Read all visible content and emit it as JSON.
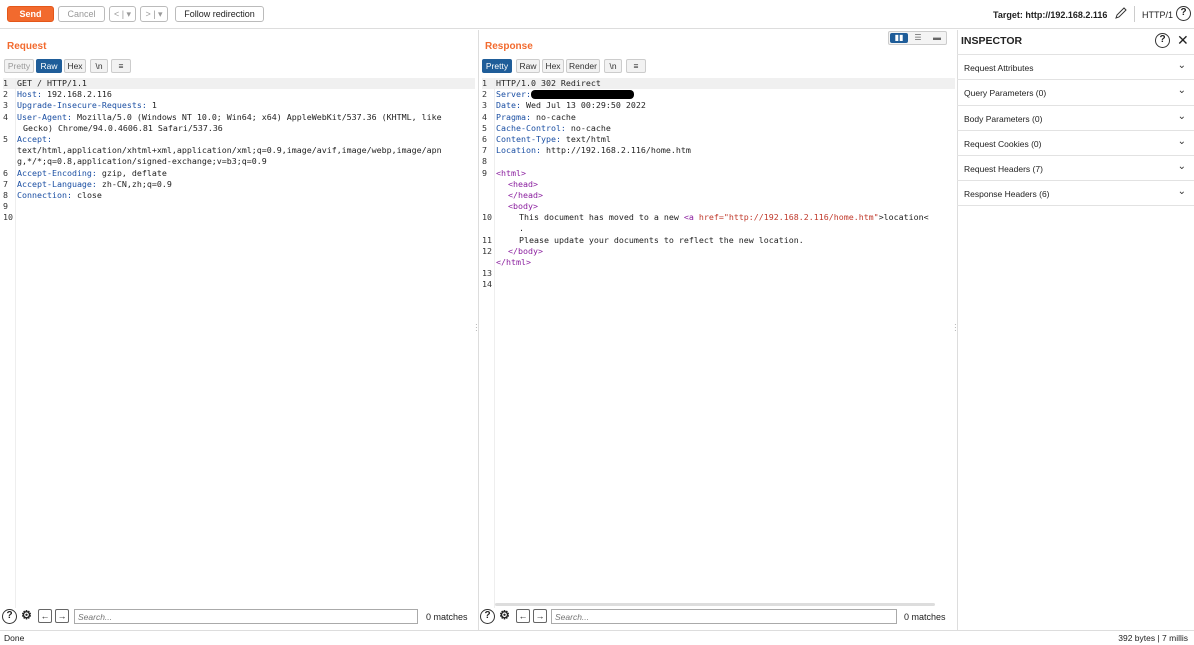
{
  "toolbar": {
    "send": "Send",
    "cancel": "Cancel",
    "back": "< | ▾",
    "forward": "> | ▾",
    "follow": "Follow redirection",
    "target": "Target: http://192.168.2.116",
    "http_version": "HTTP/1",
    "help": "?"
  },
  "request": {
    "title": "Request",
    "tabs": [
      "Pretty",
      "Raw",
      "Hex",
      "\\n",
      "≡"
    ],
    "active_tab": "Raw",
    "lines": [
      {
        "n": "1",
        "key": "",
        "val": "GET / HTTP/1.1"
      },
      {
        "n": "2",
        "key": "Host:",
        "val": " 192.168.2.116"
      },
      {
        "n": "3",
        "key": "Upgrade-Insecure-Requests:",
        "val": " 1"
      },
      {
        "n": "4",
        "key": "User-Agent:",
        "val": " Mozilla/5.0 (Windows NT 10.0; Win64; x64) AppleWebKit/537.36 (KHTML, like"
      },
      {
        "n": "",
        "key": "",
        "val": "Gecko) Chrome/94.0.4606.81 Safari/537.36"
      },
      {
        "n": "5",
        "key": "Accept:",
        "val": ""
      },
      {
        "n": "",
        "key": "",
        "val": "text/html,application/xhtml+xml,application/xml;q=0.9,image/avif,image/webp,image/apn"
      },
      {
        "n": "",
        "key": "",
        "val": "g,*/*;q=0.8,application/signed-exchange;v=b3;q=0.9"
      },
      {
        "n": "6",
        "key": "Accept-Encoding:",
        "val": " gzip, deflate"
      },
      {
        "n": "7",
        "key": "Accept-Language:",
        "val": " zh-CN,zh;q=0.9"
      },
      {
        "n": "8",
        "key": "Connection:",
        "val": " close"
      },
      {
        "n": "9",
        "key": "",
        "val": ""
      },
      {
        "n": "10",
        "key": "",
        "val": ""
      }
    ],
    "search_placeholder": "Search...",
    "matches": "0 matches"
  },
  "response": {
    "title": "Response",
    "tabs": [
      "Pretty",
      "Raw",
      "Hex",
      "Render",
      "\\n",
      "≡"
    ],
    "active_tab": "Pretty",
    "status_line": "HTTP/1.0 302 Redirect",
    "headers": [
      {
        "n": "2",
        "key": "Server:",
        "val": ""
      },
      {
        "n": "3",
        "key": "Date:",
        "val": " Wed Jul 13 00:29:50 2022"
      },
      {
        "n": "4",
        "key": "Pragma:",
        "val": " no-cache"
      },
      {
        "n": "5",
        "key": "Cache-Control:",
        "val": " no-cache"
      },
      {
        "n": "6",
        "key": "Content-Type:",
        "val": " text/html"
      },
      {
        "n": "7",
        "key": "Location:",
        "val": " http://192.168.2.116/home.htm"
      }
    ],
    "html_open": "<html>",
    "head_open": "<head>",
    "head_close": "</head>",
    "body_open": "<body>",
    "moved_text": "This document has moved to a new ",
    "a_open": "<a ",
    "href_attr": "href=",
    "href_val": "\"http://192.168.2.116/home.htm\"",
    "location_text": ">location<",
    "dot": ".",
    "update_text": "Please update your documents to reflect the new location.",
    "body_close": "</body>",
    "html_close": "</html>",
    "line_numbers": [
      "1",
      "2",
      "3",
      "4",
      "5",
      "6",
      "7",
      "8",
      "9",
      "",
      "",
      "",
      "10",
      "",
      "11",
      "12",
      "",
      "13",
      "14"
    ],
    "search_placeholder": "Search...",
    "matches": "0 matches"
  },
  "inspector": {
    "title": "INSPECTOR",
    "rows": [
      "Request Attributes",
      "Query Parameters (0)",
      "Body Parameters (0)",
      "Request Cookies (0)",
      "Request Headers (7)",
      "Response Headers (6)"
    ]
  },
  "status": {
    "left": "Done",
    "right": "392 bytes | 7 millis"
  }
}
